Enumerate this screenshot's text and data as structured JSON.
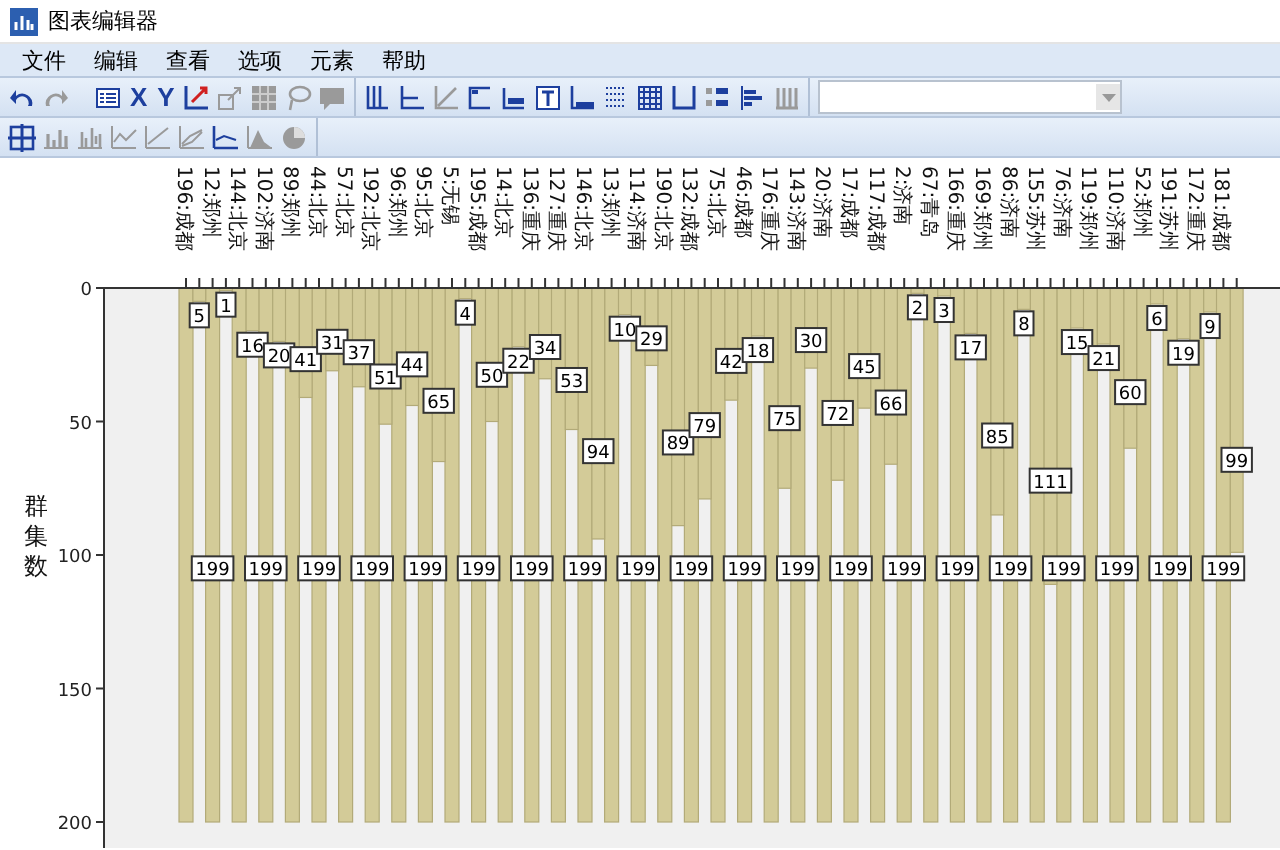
{
  "window": {
    "title": "图表编辑器"
  },
  "menu": [
    "文件",
    "编辑",
    "查看",
    "选项",
    "元素",
    "帮助"
  ],
  "toolbar": {
    "glyphs": [
      "X",
      "Y"
    ]
  },
  "chart_data": {
    "type": "bar",
    "ylabel": "群集数",
    "ylim": [
      200,
      0
    ],
    "yticks": [
      0,
      50,
      100,
      150,
      200
    ],
    "categories": [
      "196:成都",
      "12:郑州",
      "144:北京",
      "102:济南",
      "89:郑州",
      "44:北京",
      "57:北京",
      "192:北京",
      "96:郑州",
      "95:北京",
      "5:无锡",
      "195:成都",
      "14:北京",
      "136:重庆",
      "127:重庆",
      "146:北京",
      "13:郑州",
      "114:济南",
      "190:北京",
      "132:成都",
      "75:北京",
      "46:成都",
      "176:重庆",
      "143:济南",
      "20:济南",
      "17:成都",
      "117:成都",
      "2:济南",
      "67:青岛",
      "166:重庆",
      "169:郑州",
      "86:济南",
      "155:苏州",
      "76:济南",
      "119:郑州",
      "110:济南",
      "52:郑州",
      "191:苏州",
      "172:重庆",
      "181:成都"
    ],
    "series": [
      {
        "color": "#d3cb98",
        "values": [
          200,
          200,
          200,
          200,
          200,
          200,
          200,
          200,
          200,
          200,
          200,
          200,
          200,
          200,
          200,
          200,
          200,
          200,
          200,
          200,
          200,
          200,
          200,
          200,
          200,
          200,
          200,
          200,
          200,
          200,
          200,
          200,
          200,
          200,
          200,
          200,
          200,
          200,
          200,
          200
        ],
        "value_labels": [
          null,
          null,
          null,
          null,
          null,
          null,
          null,
          null,
          null,
          null,
          null,
          null,
          null,
          null,
          null,
          null,
          null,
          null,
          null,
          null,
          null,
          null,
          null,
          null,
          null,
          null,
          null,
          null,
          null,
          null,
          null,
          null,
          null,
          null,
          null,
          null,
          null,
          null,
          null,
          null
        ]
      },
      {
        "color": "#d3cb98",
        "values": [
          5,
          1,
          16,
          20,
          41,
          31,
          37,
          51,
          44,
          65,
          4,
          50,
          22,
          34,
          53,
          94,
          10,
          29,
          89,
          79,
          42,
          18,
          75,
          30,
          72,
          45,
          66,
          2,
          3,
          17,
          85,
          8,
          111,
          15,
          21,
          60,
          6,
          19,
          9,
          99
        ],
        "value_labels": [
          "5",
          "1",
          "16",
          "20",
          "41",
          "31",
          "37",
          "51",
          "44",
          "65",
          "4",
          "50",
          "22",
          "34",
          "53",
          "94",
          "10",
          "29",
          "89",
          "79",
          "42",
          "18",
          "75",
          "30",
          "72",
          "45",
          "66",
          "2",
          "3",
          "17",
          "85",
          "8",
          "111",
          "15",
          "21",
          "60",
          "6",
          "19",
          "9",
          "99"
        ]
      }
    ],
    "annotations": [
      "199",
      "199",
      "199",
      "199",
      "199",
      "199",
      "199",
      "199",
      "199",
      "199",
      "199",
      "199",
      "199",
      "199",
      "199",
      "199",
      "199",
      "199",
      "199",
      "199"
    ]
  }
}
